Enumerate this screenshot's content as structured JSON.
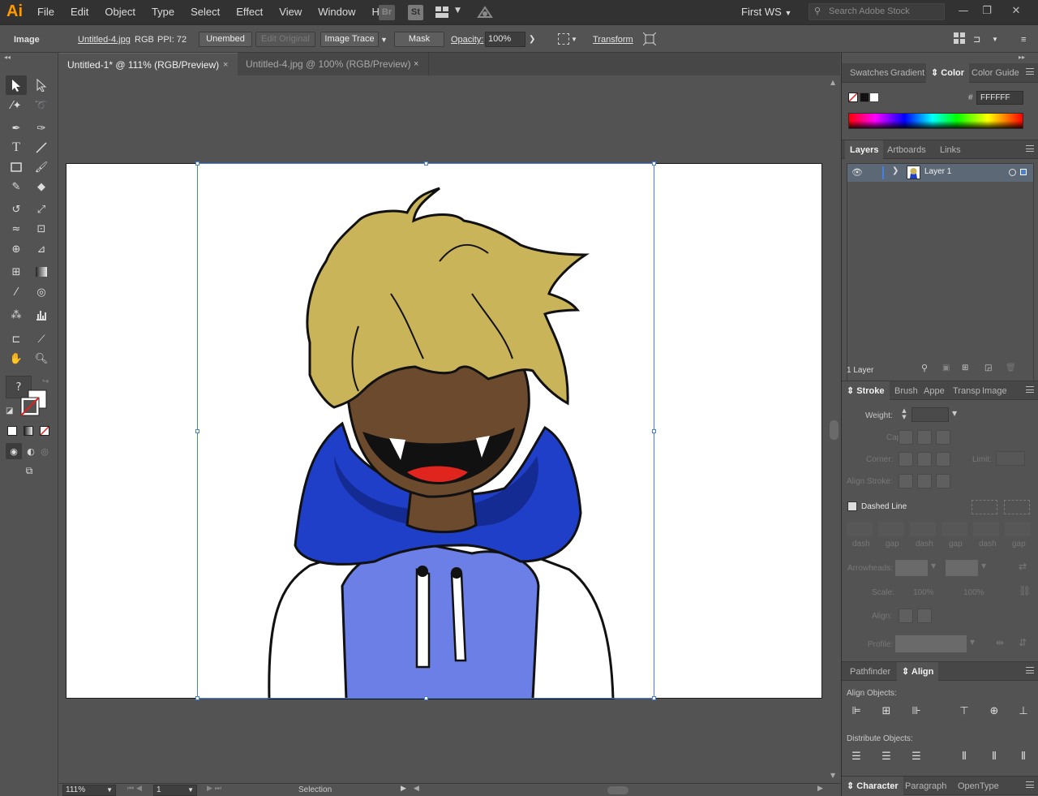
{
  "app": {
    "logo": "Ai"
  },
  "menu": [
    "File",
    "Edit",
    "Object",
    "Type",
    "Select",
    "Effect",
    "View",
    "Window",
    "Help"
  ],
  "app_bar": {
    "bridge": "Br",
    "stock": "St"
  },
  "workspace": {
    "label": "First WS",
    "search_placeholder": "Search Adobe Stock"
  },
  "control_bar": {
    "object_type": "Image",
    "file_name": "Untitled-4.jpg",
    "color_mode": "RGB",
    "ppi": "PPI: 72",
    "unembed": "Unembed",
    "edit_original": "Edit Original",
    "image_trace": "Image Trace",
    "mask": "Mask",
    "opacity_label": "Opacity:",
    "opacity_value": "100%",
    "transform": "Transform"
  },
  "tabs": [
    {
      "label": "Untitled-1* @ 111% (RGB/Preview)",
      "close": "×"
    },
    {
      "label": "Untitled-4.jpg @ 100% (RGB/Preview)",
      "close": "×"
    }
  ],
  "status": {
    "zoom": "111%",
    "artboard": "1",
    "tool": "Selection"
  },
  "panels": {
    "color": {
      "tabs": [
        "Swatches",
        "Gradient",
        "Color",
        "Color Guide"
      ],
      "hex_label": "#",
      "hex": "FFFFFF"
    },
    "layers": {
      "tabs": [
        "Layers",
        "Artboards",
        "Links"
      ],
      "layer_name": "Layer 1",
      "count": "1 Layer"
    },
    "stroke": {
      "tabs": [
        "Stroke",
        "Brush",
        "Appe",
        "Transp",
        "Image"
      ],
      "weight": "Weight:",
      "cap": "Cap:",
      "corner": "Corner:",
      "limit": "Limit:",
      "align_stroke": "Align Stroke:",
      "dashed_line": "Dashed Line",
      "dash_labels": [
        "dash",
        "gap",
        "dash",
        "gap",
        "dash",
        "gap"
      ],
      "arrowheads": "Arrowheads:",
      "scale": "Scale:",
      "scale_values": [
        "100%",
        "100%"
      ],
      "align": "Align:",
      "profile": "Profile:"
    },
    "align": {
      "tabs": [
        "Pathfinder",
        "Align"
      ],
      "align_objects": "Align Objects:",
      "distribute_objects": "Distribute Objects:"
    },
    "character": {
      "tabs": [
        "Character",
        "Paragraph",
        "OpenType"
      ]
    }
  },
  "colors": {
    "accent": "#ff9a00",
    "selection": "#4a7fd8",
    "hoodie_dark": "#1f3fc9",
    "hoodie_light": "#6b7fe6",
    "hair": "#c9b45a",
    "skin": "#6b4a2e"
  }
}
